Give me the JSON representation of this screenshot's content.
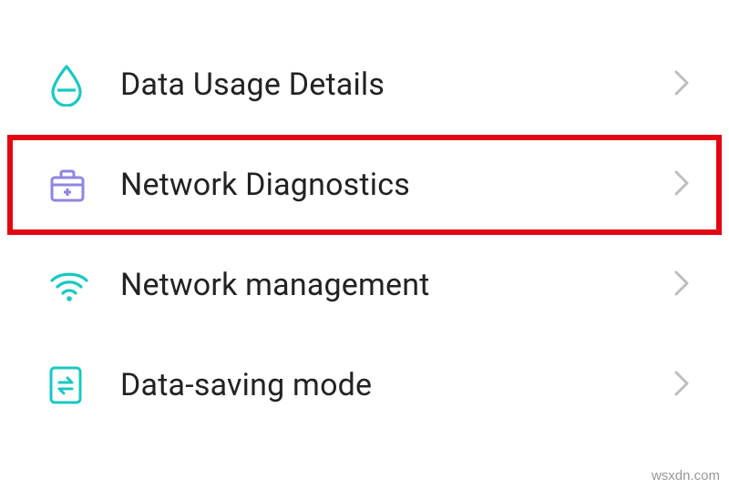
{
  "settings": {
    "items": [
      {
        "label": "Data Usage Details",
        "icon": "water-drop-icon",
        "highlighted": false
      },
      {
        "label": "Network Diagnostics",
        "icon": "toolbox-icon",
        "highlighted": true
      },
      {
        "label": "Network management",
        "icon": "wifi-icon",
        "highlighted": false
      },
      {
        "label": "Data-saving mode",
        "icon": "swap-icon",
        "highlighted": false
      }
    ]
  },
  "watermark": "wsxdn.com",
  "colors": {
    "highlight_border": "#e30613",
    "icon_teal": "#18c8c1",
    "icon_purple": "#8e86e0",
    "chevron": "#bdbdbd",
    "text": "#222222"
  }
}
